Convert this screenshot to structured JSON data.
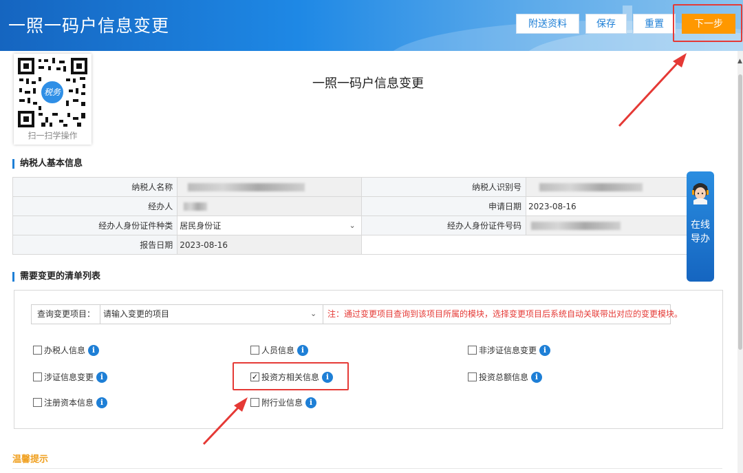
{
  "header": {
    "title": "一照一码户信息变更",
    "buttons": {
      "attach": "附送资料",
      "save": "保存",
      "reset": "重置",
      "next": "下一步"
    }
  },
  "qr": {
    "label": "扫一扫学操作",
    "badge": "税务"
  },
  "page_title": "一照一码户信息变更",
  "basic_section": {
    "title": "纳税人基本信息",
    "fields": {
      "taxpayer_name_label": "纳税人名称",
      "taxpayer_id_label": "纳税人识别号",
      "agent_label": "经办人",
      "apply_date_label": "申请日期",
      "apply_date_value": "2023-08-16",
      "agent_id_type_label": "经办人身份证件种类",
      "agent_id_type_value": "居民身份证",
      "agent_id_no_label": "经办人身份证件号码",
      "report_date_label": "报告日期",
      "report_date_value": "2023-08-16"
    }
  },
  "change_section": {
    "title": "需要变更的清单列表",
    "query": {
      "label": "查询变更项目：",
      "placeholder": "请输入变更的项目",
      "note": "注：通过变更项目查询到该项目所属的模块，选择变更项目后系统自动关联带出对应的变更模块。"
    },
    "options": [
      {
        "label": "办税人信息",
        "checked": false
      },
      {
        "label": "人员信息",
        "checked": false
      },
      {
        "label": "非涉证信息变更",
        "checked": false
      },
      {
        "label": "涉证信息变更",
        "checked": false
      },
      {
        "label": "投资方相关信息",
        "checked": true
      },
      {
        "label": "投资总额信息",
        "checked": false
      },
      {
        "label": "注册资本信息",
        "checked": false
      },
      {
        "label": "附行业信息",
        "checked": false
      }
    ]
  },
  "tips_title": "温馨提示",
  "online_guide": {
    "text": "在线导办"
  },
  "colors": {
    "header_blue": "#1e88e5",
    "primary_orange": "#ff9800",
    "annotation_red": "#e53935",
    "info_blue": "#1e7fd6",
    "tips_orange": "#f0a020"
  }
}
